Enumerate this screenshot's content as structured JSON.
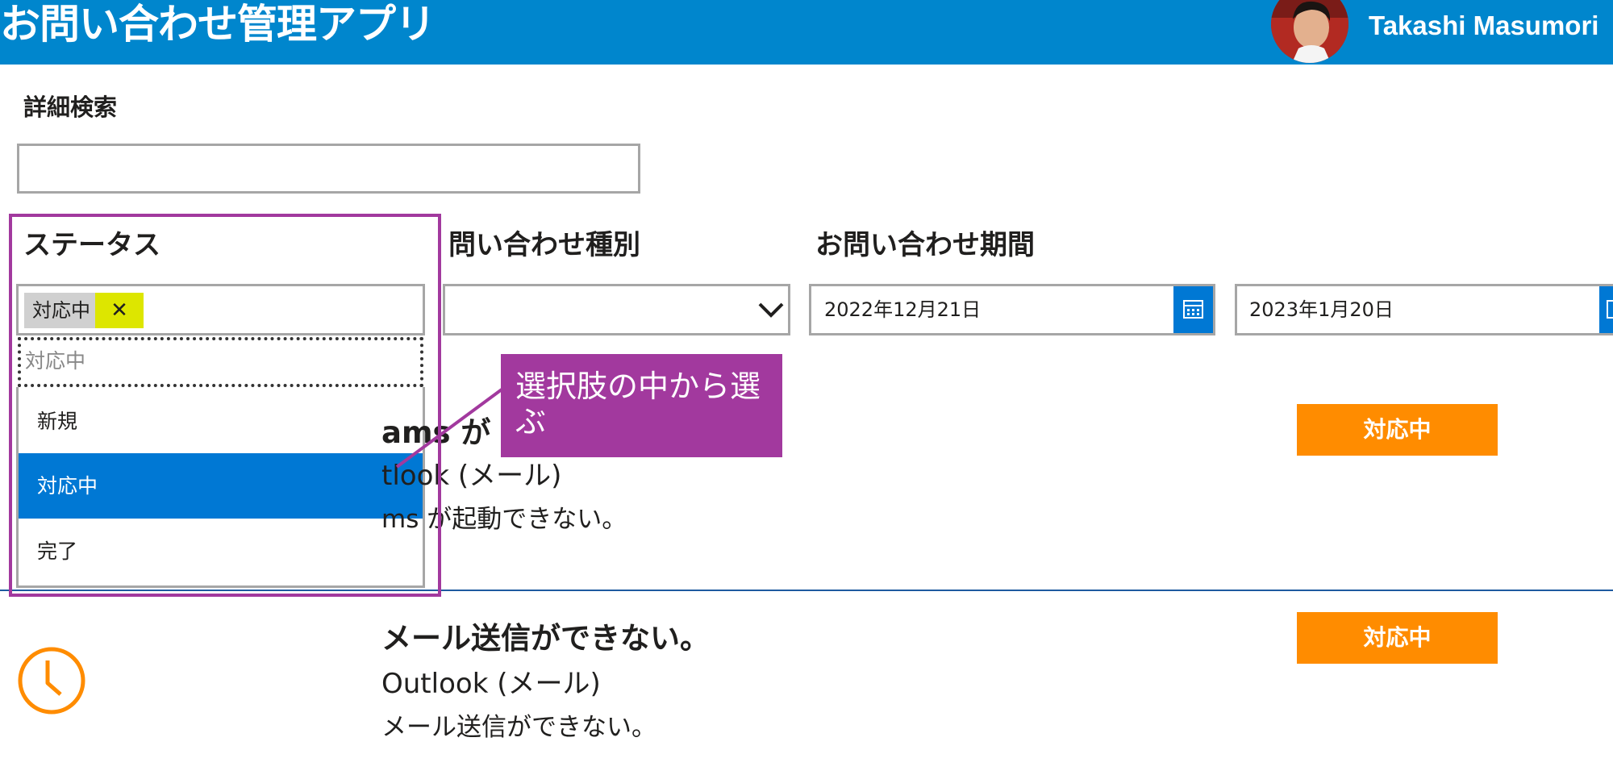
{
  "header": {
    "app_title": "お問い合わせ管理アプリ",
    "user_name": "Takashi Masumori"
  },
  "search": {
    "label": "詳細検索",
    "value": ""
  },
  "filters": {
    "status": {
      "label": "ステータス",
      "selected": [
        "対応中"
      ],
      "search_placeholder": "対応中",
      "options": [
        "新規",
        "対応中",
        "完了"
      ],
      "highlighted_option": "対応中"
    },
    "inquiry_type": {
      "label": "問い合わせ種別",
      "value": ""
    },
    "period": {
      "label": "お問い合わせ期間",
      "from": "2022年12月21日",
      "to": "2023年1月20日"
    }
  },
  "items": [
    {
      "title": "ams が",
      "category": "tlook (メール)",
      "description": "ms が起動できない。",
      "status": "対応中"
    },
    {
      "title": "メール送信ができない。",
      "category": "Outlook (メール)",
      "description": "メール送信ができない。",
      "status": "対応中",
      "icon": "clock-icon"
    }
  ],
  "annotation": {
    "callout_text": "選択肢の中から選ぶ"
  },
  "colors": {
    "header": "#0086cd",
    "accent": "#0078d4",
    "badge": "#ff8c00",
    "annotation": "#a2399e",
    "chip_highlight": "#dde600"
  }
}
